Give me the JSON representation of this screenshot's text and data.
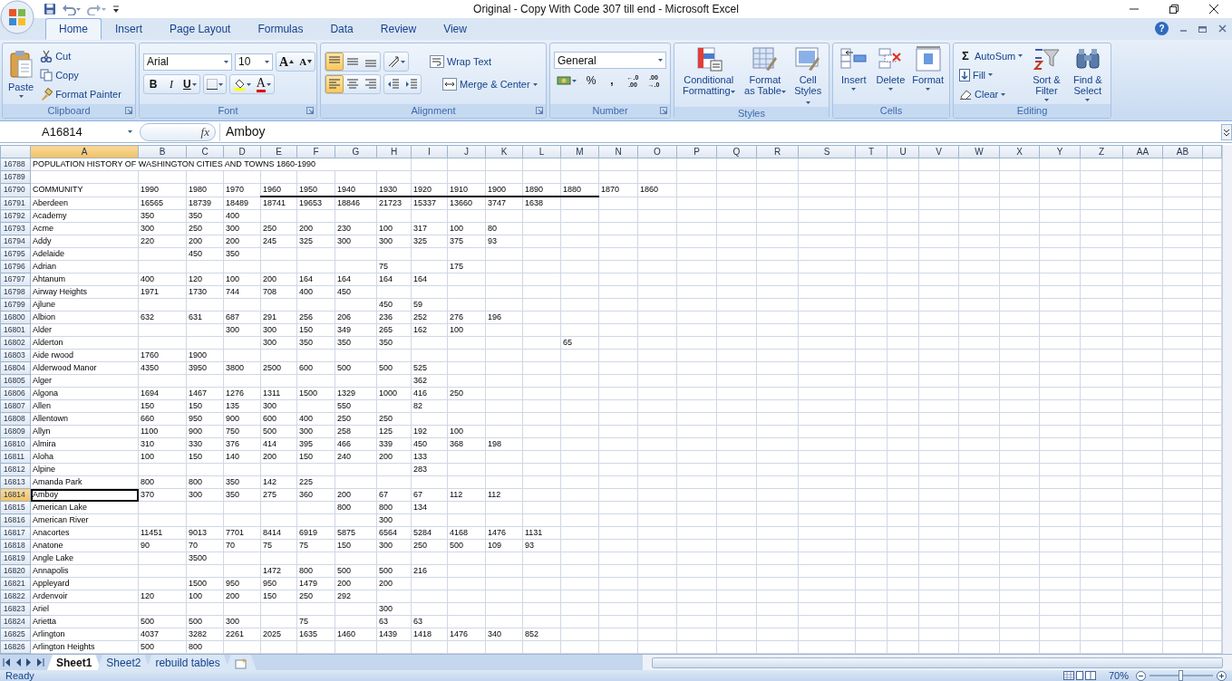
{
  "window": {
    "title": "Original - Copy With Code 307 till end - Microsoft Excel"
  },
  "tabs": [
    {
      "label": "Home",
      "selected": true
    },
    {
      "label": "Insert",
      "selected": false
    },
    {
      "label": "Page Layout",
      "selected": false
    },
    {
      "label": "Formulas",
      "selected": false
    },
    {
      "label": "Data",
      "selected": false
    },
    {
      "label": "Review",
      "selected": false
    },
    {
      "label": "View",
      "selected": false
    }
  ],
  "help_button": "?",
  "clipboard": {
    "label": "Clipboard",
    "paste": "Paste",
    "actions": [
      "Cut",
      "Copy",
      "Format Painter"
    ]
  },
  "font": {
    "label": "Font",
    "font_name": "Arial",
    "font_size": "10",
    "grow": "A",
    "shrink": "A",
    "styles": [
      "B",
      "I",
      "U"
    ],
    "font_color": "A"
  },
  "alignment": {
    "label": "Alignment",
    "vertical": [
      {
        "kind": "top",
        "selected": true
      },
      {
        "kind": "middle",
        "selected": false
      },
      {
        "kind": "bottom",
        "selected": false
      }
    ],
    "horizontal": [
      {
        "kind": "left",
        "selected": true
      },
      {
        "kind": "center",
        "selected": false
      },
      {
        "kind": "right",
        "selected": false
      }
    ],
    "wrap_text": "Wrap Text",
    "merge": "Merge & Center"
  },
  "number": {
    "label": "Number",
    "format": "General",
    "percent": "%",
    "comma": ",",
    "decimals": [
      {
        "top": "←.0",
        "bottom": ".00"
      },
      {
        "top": ".00",
        "bottom": "→.0"
      }
    ]
  },
  "styles": {
    "label": "Styles",
    "buttons": [
      "Conditional Formatting",
      "Format as Table",
      "Cell Styles"
    ]
  },
  "cells": {
    "label": "Cells",
    "buttons": [
      "Insert",
      "Delete",
      "Format"
    ]
  },
  "editing": {
    "label": "Editing",
    "sum_symbol": "Σ",
    "autosum": "AutoSum",
    "fill": "Fill",
    "clear": "Clear",
    "sort": "Sort & Filter",
    "find": "Find & Select"
  },
  "formula_bar": {
    "name_box": "A16814",
    "function_label": "fx",
    "formula": "Amboy"
  },
  "columns": [
    {
      "label": "A",
      "selected": true
    },
    {
      "label": "B",
      "selected": false
    },
    {
      "label": "C",
      "selected": false
    },
    {
      "label": "D",
      "selected": false
    },
    {
      "label": "E",
      "selected": false
    },
    {
      "label": "F",
      "selected": false
    },
    {
      "label": "G",
      "selected": false
    },
    {
      "label": "H",
      "selected": false
    },
    {
      "label": "I",
      "selected": false
    },
    {
      "label": "J",
      "selected": false
    },
    {
      "label": "K",
      "selected": false
    },
    {
      "label": "L",
      "selected": false
    },
    {
      "label": "M",
      "selected": false
    },
    {
      "label": "N",
      "selected": false
    },
    {
      "label": "O",
      "selected": false
    },
    {
      "label": "P",
      "selected": false
    },
    {
      "label": "Q",
      "selected": false
    },
    {
      "label": "R",
      "selected": false
    },
    {
      "label": "S",
      "selected": false
    },
    {
      "label": "T",
      "selected": false
    },
    {
      "label": "U",
      "selected": false
    },
    {
      "label": "V",
      "selected": false
    },
    {
      "label": "W",
      "selected": false
    },
    {
      "label": "X",
      "selected": false
    },
    {
      "label": "Y",
      "selected": false
    },
    {
      "label": "Z",
      "selected": false
    },
    {
      "label": "AA",
      "selected": false
    },
    {
      "label": "AB",
      "selected": false
    }
  ],
  "sheet_title": {
    "header": "16788",
    "text": "POPULATION HISTORY OF WASHINGTON CITIES AND TOWNS 1860-1990"
  },
  "rows": [
    {
      "header": "16789",
      "selected": false,
      "cells": []
    },
    {
      "header": "16790",
      "selected": false,
      "cells": [
        "COMMUNITY",
        "1990",
        "1980",
        "1970",
        {
          "text": "1960",
          "border_bottom": true
        },
        {
          "text": "1950",
          "border_bottom": true
        },
        {
          "text": "1940",
          "border_bottom": true
        },
        {
          "text": "1930",
          "border_bottom": true
        },
        {
          "text": "1920",
          "border_bottom": true
        },
        {
          "text": "1910",
          "border_bottom": true
        },
        {
          "text": "1900",
          "border_bottom": true
        },
        {
          "text": "1890",
          "border_bottom": true
        },
        {
          "text": "1880",
          "border_bottom": true
        },
        "1870",
        "1860"
      ]
    },
    {
      "header": "16791",
      "selected": false,
      "cells": [
        "Aberdeen",
        "16565",
        "18739",
        "18489",
        "18741",
        "19653",
        "18846",
        "21723",
        "15337",
        "13660",
        "3747",
        "1638"
      ]
    },
    {
      "header": "16792",
      "selected": false,
      "cells": [
        "Academy",
        "350",
        "350",
        "400"
      ]
    },
    {
      "header": "16793",
      "selected": false,
      "cells": [
        "Acme",
        "300",
        "250",
        "300",
        "250",
        "200",
        "230",
        "100",
        "317",
        "100",
        "80"
      ]
    },
    {
      "header": "16794",
      "selected": false,
      "cells": [
        "Addy",
        "220",
        "200",
        "200",
        "245",
        "325",
        "300",
        "300",
        "325",
        "375",
        "93"
      ]
    },
    {
      "header": "16795",
      "selected": false,
      "cells": [
        "Adelaide",
        null,
        "450",
        "350"
      ]
    },
    {
      "header": "16796",
      "selected": false,
      "cells": [
        "Adrian",
        null,
        null,
        null,
        null,
        null,
        null,
        "75",
        null,
        "175"
      ]
    },
    {
      "header": "16797",
      "selected": false,
      "cells": [
        "Ahtanum",
        "400",
        "120",
        "100",
        "200",
        "164",
        "164",
        "164",
        "164"
      ]
    },
    {
      "header": "16798",
      "selected": false,
      "cells": [
        "Airway Heights",
        "1971",
        "1730",
        "744",
        "708",
        "400",
        "450"
      ]
    },
    {
      "header": "16799",
      "selected": false,
      "cells": [
        "Ajlune",
        null,
        null,
        null,
        null,
        null,
        null,
        "450",
        "59"
      ]
    },
    {
      "header": "16800",
      "selected": false,
      "cells": [
        "Albion",
        "632",
        "631",
        "687",
        "291",
        "256",
        "206",
        "236",
        "252",
        "276",
        "196"
      ]
    },
    {
      "header": "16801",
      "selected": false,
      "cells": [
        "Alder",
        null,
        null,
        "300",
        "300",
        "150",
        "349",
        "265",
        "162",
        "100"
      ]
    },
    {
      "header": "16802",
      "selected": false,
      "cells": [
        "Alderton",
        null,
        null,
        null,
        "300",
        "350",
        "350",
        "350",
        null,
        null,
        null,
        null,
        "65"
      ]
    },
    {
      "header": "16803",
      "selected": false,
      "cells": [
        "Aide rwood",
        "1760",
        "1900"
      ]
    },
    {
      "header": "16804",
      "selected": false,
      "cells": [
        "Alderwood Manor",
        "4350",
        "3950",
        "3800",
        "2500",
        "600",
        "500",
        "500",
        "525"
      ]
    },
    {
      "header": "16805",
      "selected": false,
      "cells": [
        "Alger",
        null,
        null,
        null,
        null,
        null,
        null,
        null,
        "362"
      ]
    },
    {
      "header": "16806",
      "selected": false,
      "cells": [
        "Algona",
        "1694",
        "1467",
        "1276",
        "1311",
        "1500",
        "1329",
        "1000",
        "416",
        "250"
      ]
    },
    {
      "header": "16807",
      "selected": false,
      "cells": [
        "Allen",
        "150",
        "150",
        "135",
        "300",
        null,
        "550",
        null,
        "82"
      ]
    },
    {
      "header": "16808",
      "selected": false,
      "cells": [
        "Allentown",
        "660",
        "950",
        "900",
        "600",
        "400",
        "250",
        "250"
      ]
    },
    {
      "header": "16809",
      "selected": false,
      "cells": [
        "Allyn",
        "1100",
        "900",
        "750",
        "500",
        "300",
        "258",
        "125",
        "192",
        "100"
      ]
    },
    {
      "header": "16810",
      "selected": false,
      "cells": [
        "Almira",
        "310",
        "330",
        "376",
        "414",
        "395",
        "466",
        "339",
        "450",
        "368",
        "198"
      ]
    },
    {
      "header": "16811",
      "selected": false,
      "cells": [
        "Aloha",
        "100",
        "150",
        "140",
        "200",
        "150",
        "240",
        "200",
        "133"
      ]
    },
    {
      "header": "16812",
      "selected": false,
      "cells": [
        "Alpine",
        null,
        null,
        null,
        null,
        null,
        null,
        null,
        "283"
      ]
    },
    {
      "header": "16813",
      "selected": false,
      "cells": [
        "Amanda Park",
        "800",
        "800",
        "350",
        "142",
        "225"
      ]
    },
    {
      "header": "16814",
      "selected": true,
      "cells": [
        "Amboy",
        "370",
        "300",
        "350",
        "275",
        "360",
        "200",
        "67",
        "67",
        "112",
        "112"
      ]
    },
    {
      "header": "16815",
      "selected": false,
      "cells": [
        "American Lake",
        null,
        null,
        null,
        null,
        null,
        "800",
        "800",
        "134"
      ]
    },
    {
      "header": "16816",
      "selected": false,
      "cells": [
        "American River",
        null,
        null,
        null,
        null,
        null,
        null,
        "300"
      ]
    },
    {
      "header": "16817",
      "selected": false,
      "cells": [
        "Anacortes",
        "11451",
        "9013",
        "7701",
        "8414",
        "6919",
        "5875",
        "6564",
        "5284",
        "4168",
        "1476",
        "1131"
      ]
    },
    {
      "header": "16818",
      "selected": false,
      "cells": [
        "Anatone",
        "90",
        "70",
        "70",
        "75",
        "75",
        "150",
        "300",
        "250",
        "500",
        "109",
        "93"
      ]
    },
    {
      "header": "16819",
      "selected": false,
      "cells": [
        "Angle Lake",
        null,
        "3500"
      ]
    },
    {
      "header": "16820",
      "selected": false,
      "cells": [
        "Annapolis",
        null,
        null,
        null,
        "1472",
        "800",
        "500",
        "500",
        "216"
      ]
    },
    {
      "header": "16821",
      "selected": false,
      "cells": [
        "Appleyard",
        null,
        "1500",
        "950",
        "950",
        "1479",
        "200",
        "200"
      ]
    },
    {
      "header": "16822",
      "selected": false,
      "cells": [
        "Ardenvoir",
        "120",
        "100",
        "200",
        "150",
        "250",
        "292"
      ]
    },
    {
      "header": "16823",
      "selected": false,
      "cells": [
        "Ariel",
        null,
        null,
        null,
        null,
        null,
        null,
        "300"
      ]
    },
    {
      "header": "16824",
      "selected": false,
      "cells": [
        "Arietta",
        "500",
        "500",
        "300",
        null,
        "75",
        null,
        "63",
        "63"
      ]
    },
    {
      "header": "16825",
      "selected": false,
      "cells": [
        "Arlington",
        "4037",
        "3282",
        "2261",
        "2025",
        "1635",
        "1460",
        "1439",
        "1418",
        "1476",
        "340",
        "852"
      ]
    },
    {
      "header": "16826",
      "selected": false,
      "cells": [
        "Arlington Heights",
        "500",
        "800"
      ]
    }
  ],
  "sheet_tabs": [
    {
      "label": "Sheet1",
      "selected": true
    },
    {
      "label": "Sheet2",
      "selected": false
    },
    {
      "label": "rebuild tables",
      "selected": false
    }
  ],
  "status_bar": {
    "status": "Ready",
    "zoom": "70%",
    "zoom_slider": {
      "level": 0.45
    }
  }
}
